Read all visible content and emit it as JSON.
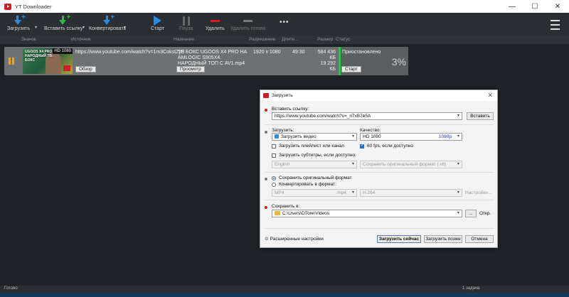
{
  "window": {
    "title": "YT Downloader",
    "minimize": "—",
    "maximize": "☐",
    "close": "✕"
  },
  "toolbar": {
    "download": "Загрузить",
    "paste_link": "Вставить ссылку",
    "convert": "Конвертировать",
    "start": "Старт",
    "pause": "Пауза",
    "delete": "Удалить",
    "delete_done": "Удалить готово",
    "more": "•••"
  },
  "columns": {
    "icon": "Значок",
    "source": "Источник",
    "name": "Название",
    "resolution": "Разрешение",
    "duration": "Длите...",
    "size": "Размер",
    "status": "Статус"
  },
  "item": {
    "thumb_text": "UGOOS X4 PRO НАРОДНЫЙ ТВ-БОКС",
    "thumb_res": "HD 1080",
    "url": "https://www.youtube.com/watch?v=1m3CokstZyE",
    "browse": "Обзор",
    "name": "ТВ БОКС UGOOS X4 PRO НА AMLOGIC S905X4. НАРОДНЫЙ ТОП С AV1.mp4",
    "preview": "Просмотр",
    "resolution": "1920 x 1080",
    "duration": "49:30",
    "size_done": "584 436 КБ",
    "size_total": "19 292 КБ",
    "status": "Приостановлено",
    "start": "Старт",
    "percent": "3%",
    "progress": 0.03
  },
  "statusbar": {
    "left": "Готово",
    "right": "1 задача"
  },
  "dialog": {
    "title": "Загрузить",
    "paste_link_label": "Вставить ссылку:",
    "url": "https://www.youtube.com/watch?v=_ri7xB7e5A",
    "paste_btn": "Вставить",
    "download_label": "Загрузить:",
    "download_value": "Загрузить видео",
    "quality_label": "Качество:",
    "quality_value": "HD 1080",
    "quality_sub": "1080p",
    "playlist": "Загрузить плейлист или канал",
    "fps60": "60 fps, если доступно",
    "subs": "Загрузить субтитры, если доступно:",
    "subs_lang": "English",
    "subs_format": "Сохранить оригинальный формат (.vtt)",
    "keep_format": "Сохранить оригинальный формат",
    "convert_to": "Конвертировать в формат:",
    "conv_format": "MP4",
    "conv_ext": ".mp4",
    "conv_codec": "H.264",
    "conv_settings": "Настройки...",
    "save_to_label": "Сохранить в:",
    "path": "C:\\Users\\DTore\\Videos",
    "browse_btn": "...",
    "open_btn": "Откр.",
    "advanced": "Расширенные настройки",
    "download_now": "Загрузить сейчас",
    "download_later": "Загрузить позже",
    "cancel": "Отмена"
  },
  "colors": {
    "accent": "#2a8de0",
    "green": "#2fb84a",
    "required_dot": "#c62020"
  }
}
